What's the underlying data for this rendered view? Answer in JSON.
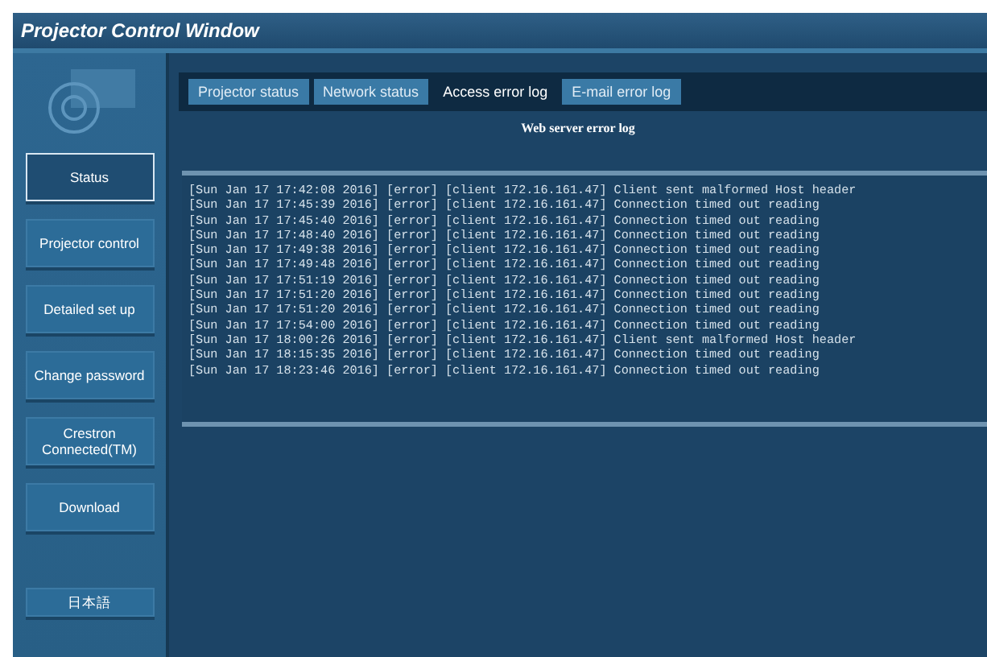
{
  "window": {
    "title": "Projector Control Window"
  },
  "sidebar": {
    "items": [
      {
        "label": "Status",
        "selected": true
      },
      {
        "label": "Projector control",
        "selected": false
      },
      {
        "label": "Detailed set up",
        "selected": false
      },
      {
        "label": "Change password",
        "selected": false
      },
      {
        "label": "Crestron Connected(TM)",
        "selected": false
      },
      {
        "label": "Download",
        "selected": false
      }
    ],
    "language_button": "日本語"
  },
  "tabs": [
    {
      "label": "Projector status",
      "selected": false
    },
    {
      "label": "Network status",
      "selected": false
    },
    {
      "label": "Access error log",
      "selected": true
    },
    {
      "label": "E-mail error log",
      "selected": false
    }
  ],
  "log": {
    "title": "Web server error log",
    "lines": [
      "[Sun Jan 17 17:42:08 2016] [error] [client 172.16.161.47] Client sent malformed Host header",
      "[Sun Jan 17 17:45:39 2016] [error] [client 172.16.161.47] Connection timed out reading",
      "[Sun Jan 17 17:45:40 2016] [error] [client 172.16.161.47] Connection timed out reading",
      "[Sun Jan 17 17:48:40 2016] [error] [client 172.16.161.47] Connection timed out reading",
      "[Sun Jan 17 17:49:38 2016] [error] [client 172.16.161.47] Connection timed out reading",
      "[Sun Jan 17 17:49:48 2016] [error] [client 172.16.161.47] Connection timed out reading",
      "[Sun Jan 17 17:51:19 2016] [error] [client 172.16.161.47] Connection timed out reading",
      "[Sun Jan 17 17:51:20 2016] [error] [client 172.16.161.47] Connection timed out reading",
      "[Sun Jan 17 17:51:20 2016] [error] [client 172.16.161.47] Connection timed out reading",
      "[Sun Jan 17 17:54:00 2016] [error] [client 172.16.161.47] Connection timed out reading",
      "[Sun Jan 17 18:00:26 2016] [error] [client 172.16.161.47] Client sent malformed Host header",
      "[Sun Jan 17 18:15:35 2016] [error] [client 172.16.161.47] Connection timed out reading",
      "[Sun Jan 17 18:23:46 2016] [error] [client 172.16.161.47] Connection timed out reading"
    ]
  }
}
